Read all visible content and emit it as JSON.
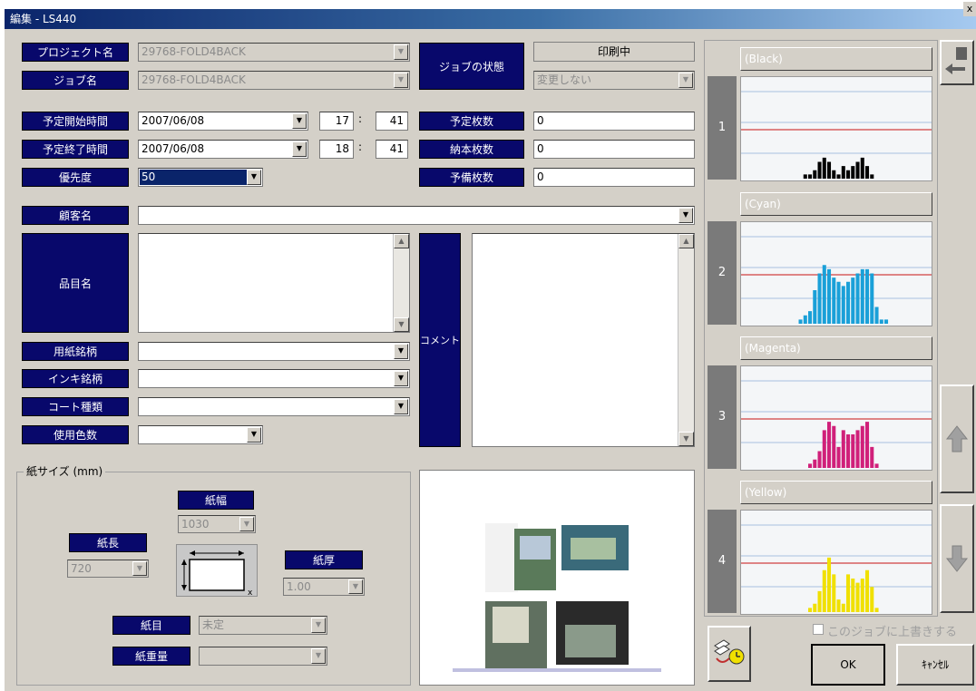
{
  "window": {
    "title": "編集 - LS440",
    "close": "x"
  },
  "labels": {
    "project": "プロジェクト名",
    "job": "ジョブ名",
    "job_status": "ジョブの状態",
    "start": "予定開始時間",
    "end": "予定終了時間",
    "priority": "優先度",
    "planned_sheets": "予定枚数",
    "delivered_sheets": "納本枚数",
    "spare_sheets": "予備枚数",
    "customer": "顧客名",
    "item": "品目名",
    "comment": "コメント",
    "paper_brand": "用紙銘柄",
    "ink_brand": "インキ銘柄",
    "coat_type": "コート種類",
    "colors_used": "使用色数"
  },
  "fields": {
    "project": "29768-FOLD4BACK",
    "job": "29768-FOLD4BACK",
    "status_current": "印刷中",
    "status_select": "変更しない",
    "start_date": "2007/06/08",
    "start_hour": "17",
    "start_min": "41",
    "end_date": "2007/06/08",
    "end_hour": "18",
    "end_min": "41",
    "time_sep": ":",
    "priority": "50",
    "planned_sheets": "0",
    "delivered_sheets": "0",
    "spare_sheets": "0",
    "customer": "",
    "paper_brand": "",
    "ink_brand": "",
    "coat_type": "",
    "colors_used": ""
  },
  "paper": {
    "group_title": "紙サイズ (mm)",
    "width_label": "紙幅",
    "width": "1030",
    "length_label": "紙長",
    "length": "720",
    "thickness_label": "紙厚",
    "thickness": "1.00",
    "grain_label": "紙目",
    "grain": "未定",
    "weight_label": "紙重量",
    "weight": ""
  },
  "channels": [
    {
      "num": "1",
      "name": "(Black)",
      "color": "#000000",
      "values": [
        0,
        0,
        0,
        0,
        0,
        0,
        0,
        0,
        0,
        0,
        0,
        0,
        0,
        1,
        1,
        2,
        4,
        5,
        4,
        2,
        1,
        3,
        2,
        3,
        4,
        5,
        3,
        1,
        0,
        0,
        0,
        0,
        0,
        0,
        0,
        0,
        0,
        0,
        0,
        0
      ]
    },
    {
      "num": "2",
      "name": "(Cyan)",
      "color": "#1aa0d8",
      "values": [
        0,
        0,
        0,
        0,
        0,
        0,
        0,
        0,
        0,
        0,
        0,
        0,
        1,
        2,
        3,
        8,
        12,
        14,
        13,
        11,
        10,
        9,
        10,
        11,
        12,
        13,
        13,
        12,
        4,
        1,
        1,
        0,
        0,
        0,
        0,
        0,
        0,
        0,
        0,
        0
      ]
    },
    {
      "num": "3",
      "name": "(Magenta)",
      "color": "#d0207a",
      "values": [
        0,
        0,
        0,
        0,
        0,
        0,
        0,
        0,
        0,
        0,
        0,
        0,
        0,
        0,
        1,
        2,
        4,
        9,
        11,
        10,
        5,
        9,
        8,
        8,
        9,
        10,
        11,
        5,
        1,
        0,
        0,
        0,
        0,
        0,
        0,
        0,
        0,
        0,
        0,
        0
      ]
    },
    {
      "num": "4",
      "name": "(Yellow)",
      "color": "#f0e000",
      "values": [
        0,
        0,
        0,
        0,
        0,
        0,
        0,
        0,
        0,
        0,
        0,
        0,
        0,
        0,
        1,
        2,
        5,
        10,
        13,
        9,
        3,
        2,
        9,
        8,
        7,
        8,
        10,
        6,
        1,
        0,
        0,
        0,
        0,
        0,
        0,
        0,
        0,
        0,
        0,
        0
      ]
    }
  ],
  "actions": {
    "overwrite_label": "このジョブに上書きする",
    "ok": "OK",
    "cancel": "ｷｬﾝｾﾙ"
  }
}
